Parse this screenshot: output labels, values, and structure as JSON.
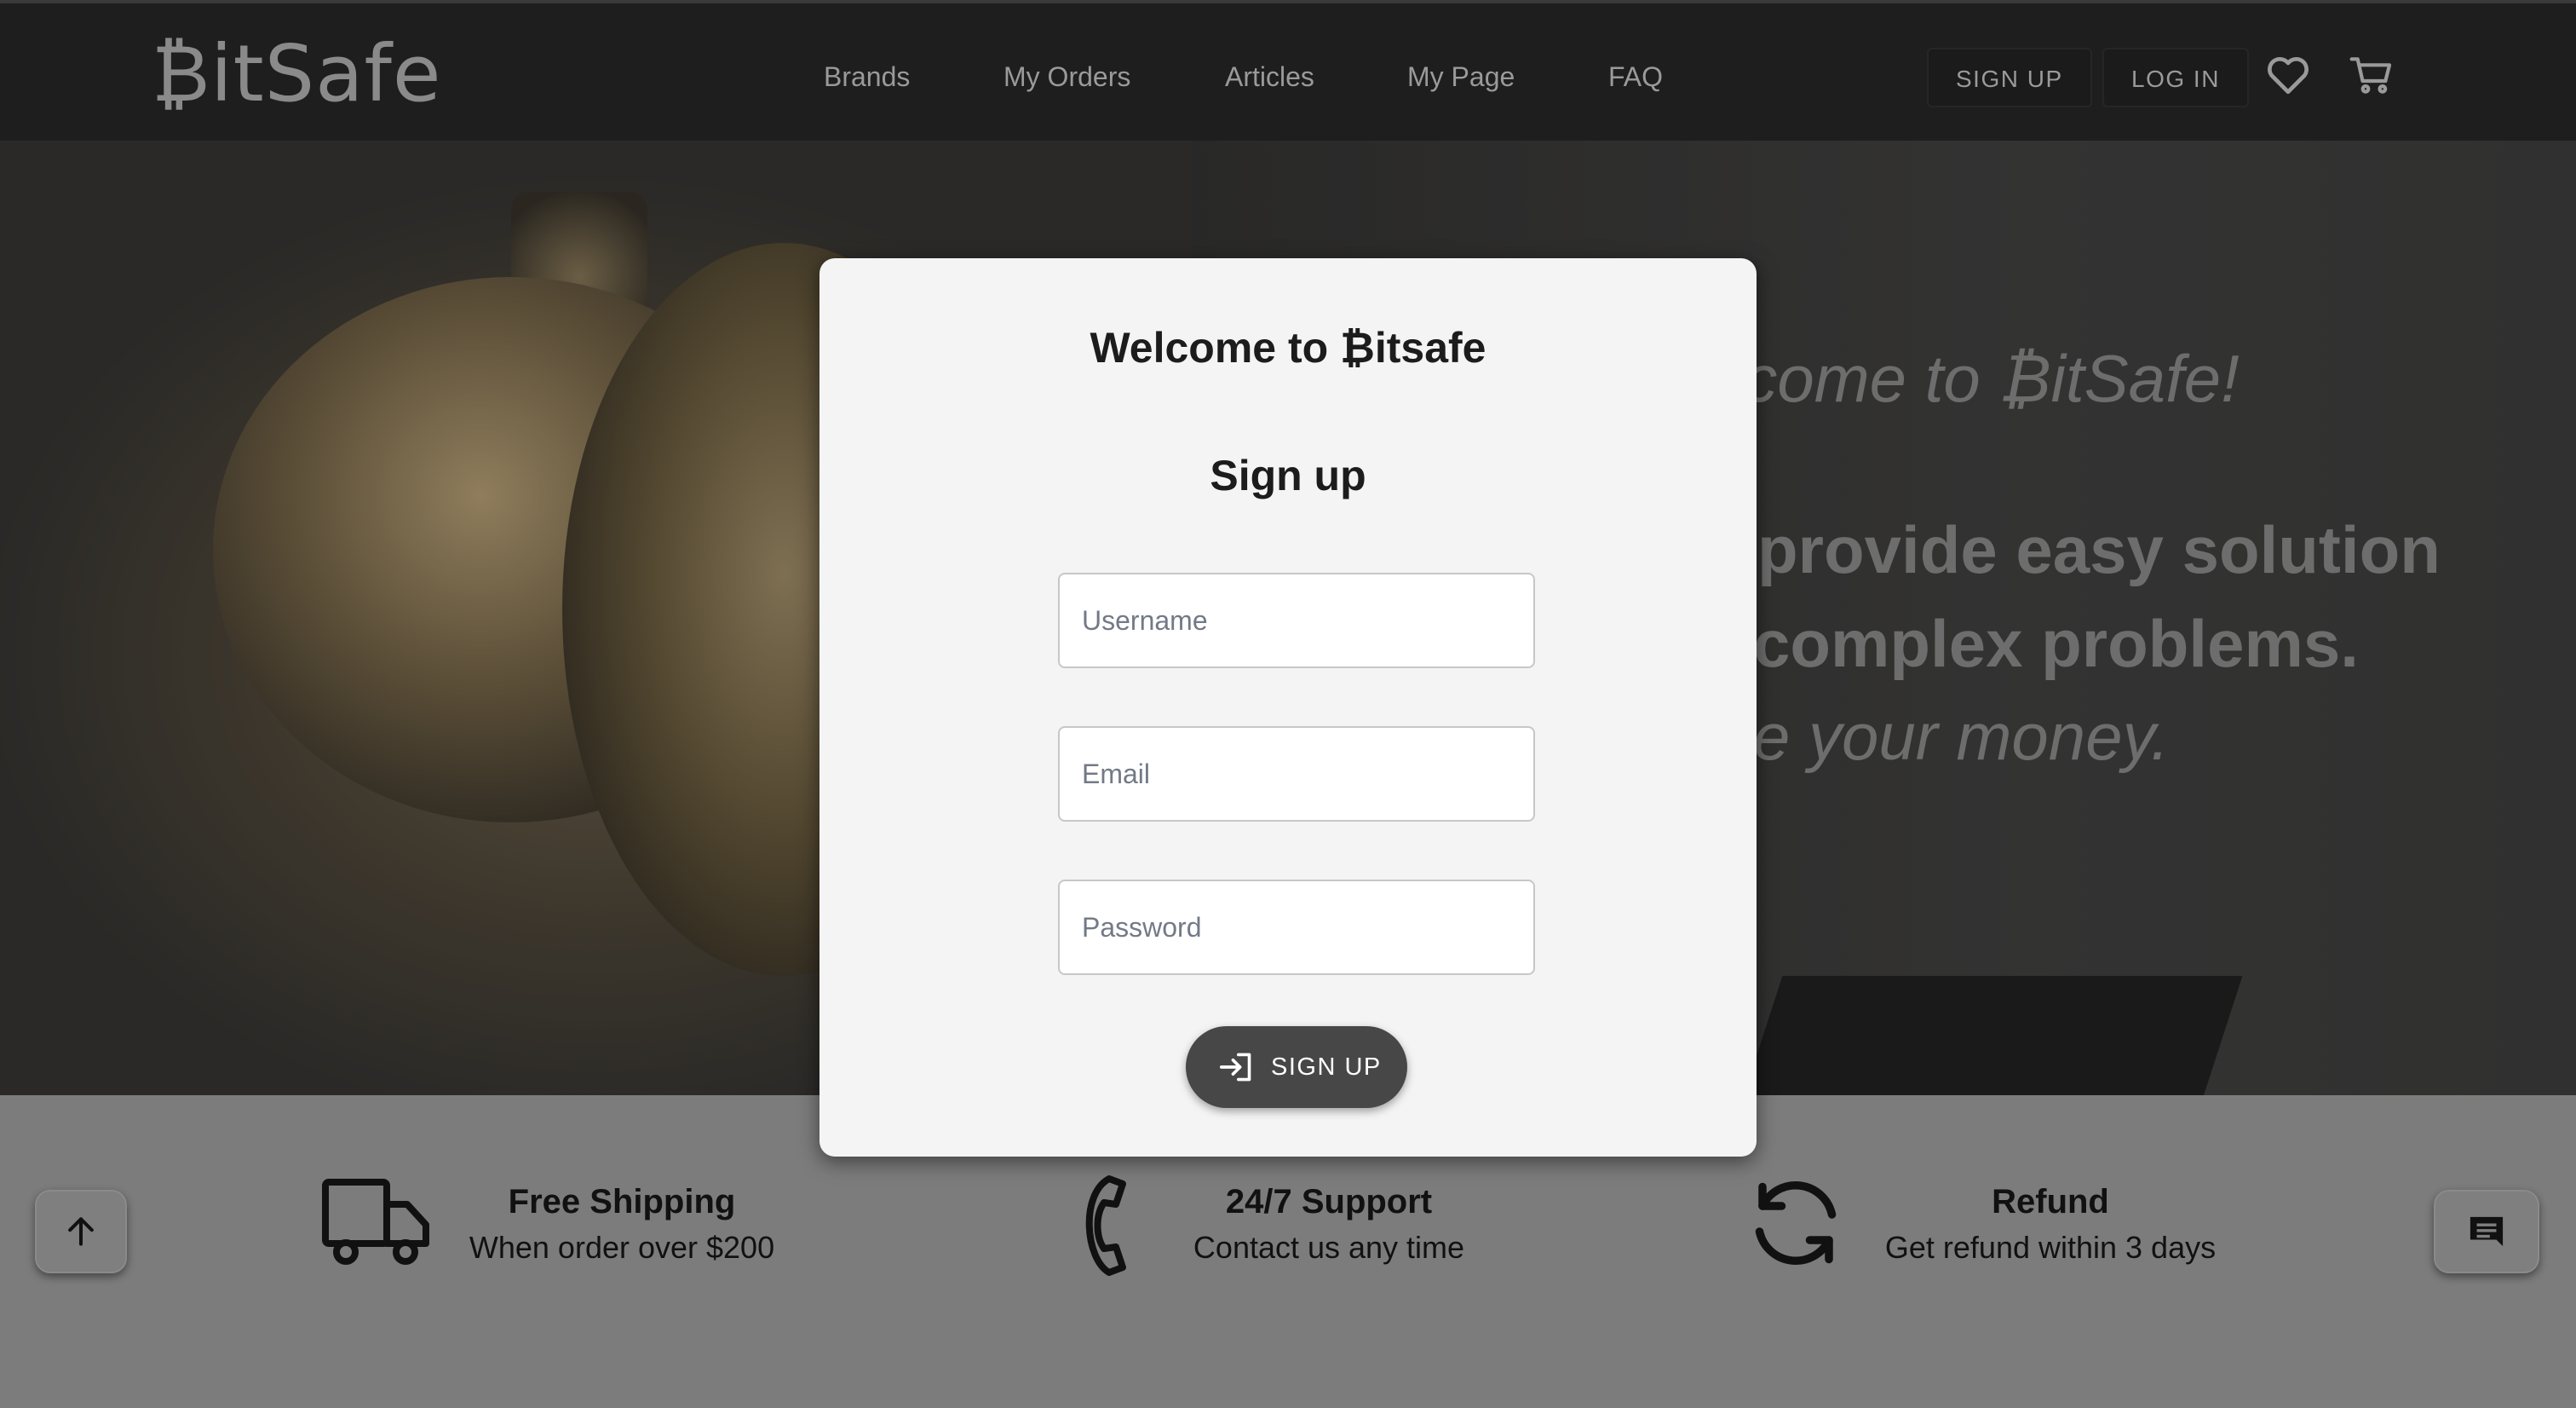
{
  "header": {
    "logo": "₿itSafe",
    "nav": [
      {
        "label": "Brands"
      },
      {
        "label": "My Orders"
      },
      {
        "label": "Articles"
      },
      {
        "label": "My Page"
      },
      {
        "label": "FAQ"
      }
    ],
    "signup_label": "SIGN UP",
    "login_label": "LOG IN",
    "wishlist_icon": "heart-icon",
    "cart_icon": "cart-icon"
  },
  "hero": {
    "line1": "lcome to ₿itSafe!",
    "line2": "provide easy solution",
    "line3": "complex problems.",
    "line4": "e your money."
  },
  "modal": {
    "title": "Welcome to ₿itsafe",
    "subtitle": "Sign up",
    "username_placeholder": "Username",
    "email_placeholder": "Email",
    "password_placeholder": "Password",
    "submit_label": "SIGN UP",
    "submit_icon": "login-arrow-icon"
  },
  "features": [
    {
      "icon": "truck-icon",
      "title": "Free Shipping",
      "subtitle": "When order over $200"
    },
    {
      "icon": "phone-icon",
      "title": "24/7 Support",
      "subtitle": "Contact us any time"
    },
    {
      "icon": "refresh-icon",
      "title": "Refund",
      "subtitle": "Get refund within 3 days"
    }
  ],
  "floating": {
    "scroll_top_icon": "arrow-up-icon",
    "chat_icon": "chat-icon"
  },
  "colors": {
    "header_bg": "#1e1e1e",
    "modal_bg": "#f4f4f4",
    "button_bg": "#474747",
    "features_bg": "#7c7c7c"
  }
}
